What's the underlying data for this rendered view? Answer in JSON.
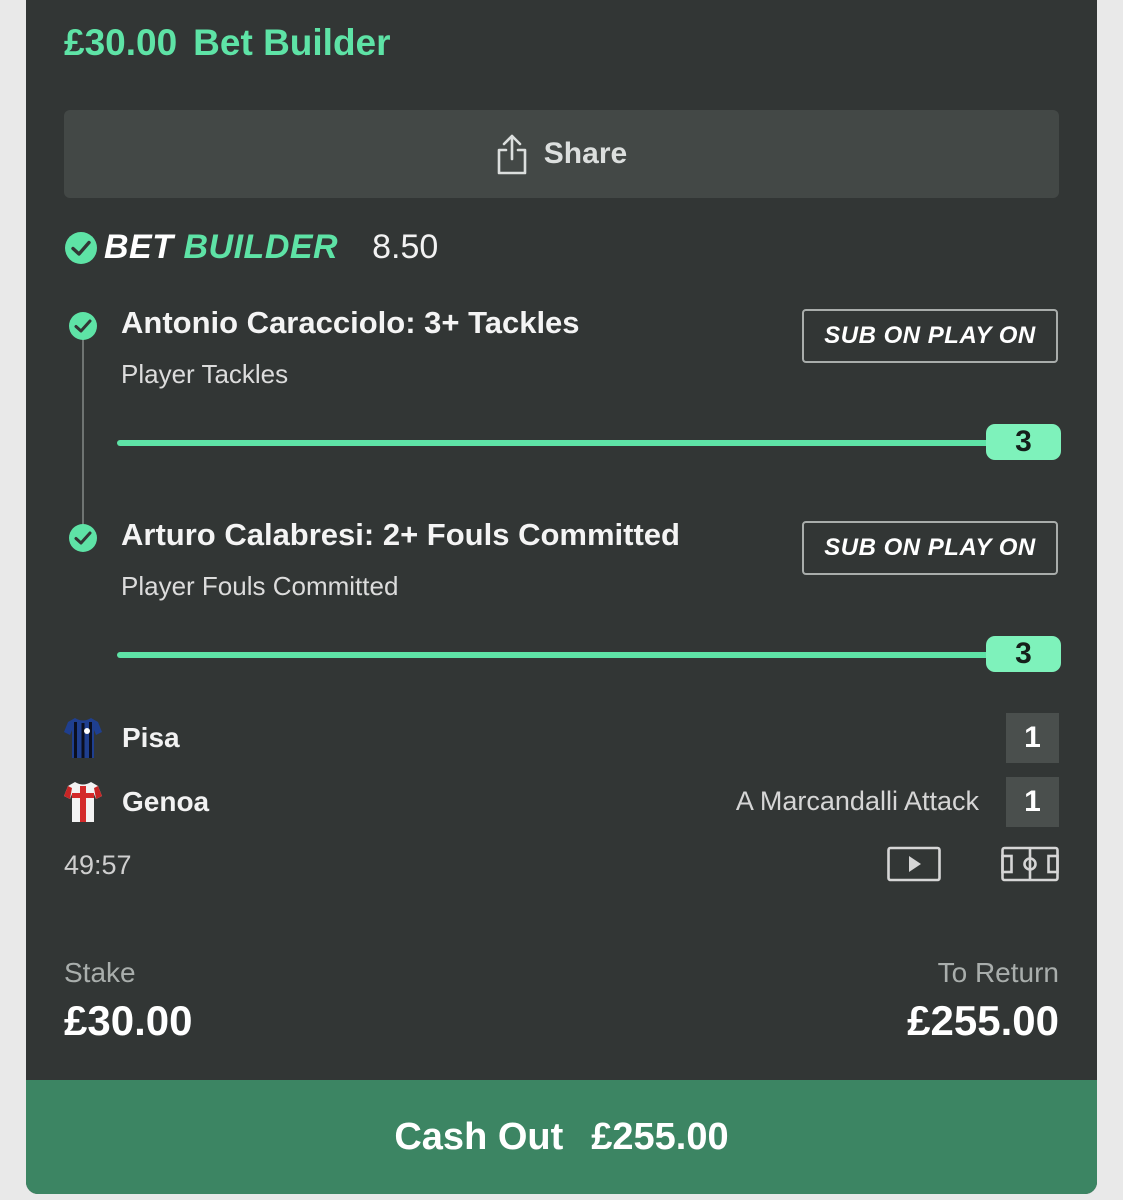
{
  "header": {
    "stake": "£30.00",
    "title": "Bet Builder"
  },
  "share": {
    "label": "Share",
    "icon": "share-icon"
  },
  "bet_builder": {
    "label_part1": "BET",
    "label_part2": "BUILDER",
    "odds": "8.50"
  },
  "selections": [
    {
      "title": "Antonio Caracciolo: 3+ Tackles",
      "market": "Player Tackles",
      "badge": "SUB ON PLAY ON",
      "progress_value": "3",
      "progress_fraction": 1.0
    },
    {
      "title": "Arturo Calabresi: 2+ Fouls Committed",
      "market": "Player Fouls Committed",
      "badge": "SUB ON PLAY ON",
      "progress_value": "3",
      "progress_fraction": 1.0
    }
  ],
  "match": {
    "teams": [
      {
        "name": "Pisa",
        "score": "1",
        "kit_icon": "pisa-shirt-icon"
      },
      {
        "name": "Genoa",
        "score": "1",
        "kit_icon": "genoa-shirt-icon"
      }
    ],
    "event": "A Marcandalli Attack",
    "clock": "49:57"
  },
  "footer": {
    "stake_label": "Stake",
    "stake_value": "£30.00",
    "return_label": "To Return",
    "return_value": "£255.00"
  },
  "cashout": {
    "label": "Cash Out",
    "amount": "£255.00"
  },
  "colors": {
    "accent": "#5ee3a6",
    "card": "#323635",
    "cashout": "#3c8563"
  }
}
